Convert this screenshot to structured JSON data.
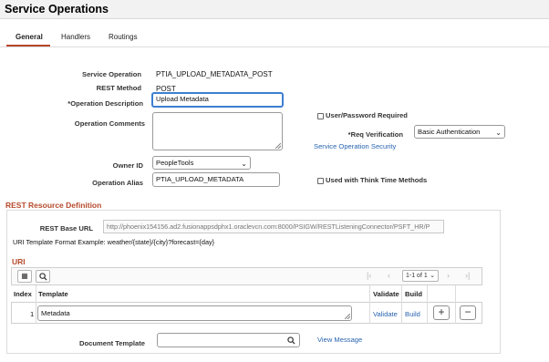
{
  "header": {
    "title": "Service Operations"
  },
  "tabs": [
    {
      "label": "General",
      "active": true
    },
    {
      "label": "Handlers",
      "active": false
    },
    {
      "label": "Routings",
      "active": false
    }
  ],
  "form": {
    "service_operation_label": "Service Operation",
    "service_operation_value": "PTIA_UPLOAD_METADATA_POST",
    "rest_method_label": "REST Method",
    "rest_method_value": "POST",
    "operation_description_label": "*Operation Description",
    "operation_description_value": "Upload Metadata",
    "operation_comments_label": "Operation Comments",
    "owner_id_label": "Owner ID",
    "owner_id_value": "PeopleTools",
    "operation_alias_label": "Operation Alias",
    "operation_alias_value": "PTIA_UPLOAD_METADATA",
    "user_password_required_label": "User/Password Required",
    "user_password_required_checked": false,
    "req_verification_label": "*Req Verification",
    "req_verification_value": "Basic Authentication",
    "service_operation_security_link": "Service Operation Security",
    "used_with_think_time_label": "Used with Think Time Methods",
    "used_with_think_time_checked": false
  },
  "rest_resource": {
    "section_title": "REST Resource Definition",
    "base_url_label": "REST Base URL",
    "base_url_value": "http://phoenix154156.ad2.fusionappsdphx1.oraclevcn.com:8000/PSIGW/RESTListeningConnector/PSFT_HR/P",
    "uri_template_example": "URI Template Format Example: weather/{state}/{city}?forecast={day}",
    "uri_title": "URI",
    "pager_text": "1-1 of 1",
    "columns": {
      "index": "Index",
      "template": "Template",
      "validate": "Validate",
      "build": "Build"
    },
    "rows": [
      {
        "index": "1",
        "template": "Metadata",
        "validate_link": "Validate",
        "build_link": "Build"
      }
    ],
    "document_template_label": "Document Template",
    "document_template_value": "",
    "view_message_link": "View Message"
  },
  "colors": {
    "accent": "#b54a2c",
    "link": "#2a64b0",
    "focus": "#3d7fd1"
  },
  "icons": {
    "grid_personalize": "grid-icon",
    "grid_find": "search-icon",
    "lookup": "search-icon",
    "add_row": "plus-icon",
    "delete_row": "minus-icon"
  }
}
